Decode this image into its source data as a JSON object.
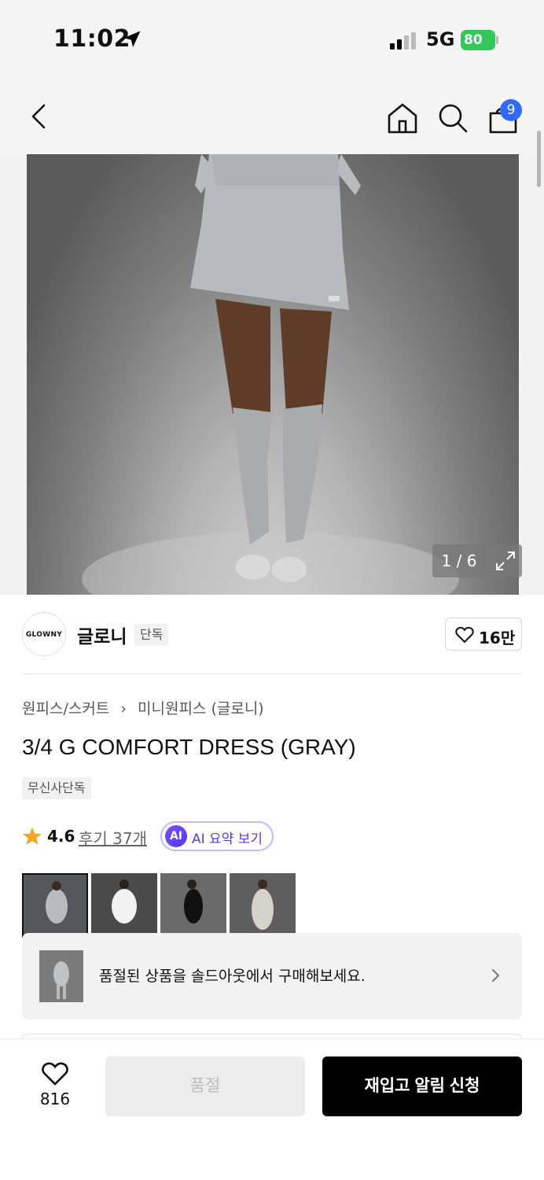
{
  "status_bar": {
    "time": "11:02",
    "network": "5G",
    "battery": "80"
  },
  "nav": {
    "cart_count": "9"
  },
  "gallery": {
    "counter": "1 / 6"
  },
  "brand": {
    "logo_text": "GLOWNY",
    "name": "글로니",
    "tag": "단독",
    "likes": "16만"
  },
  "product": {
    "breadcrumb": [
      "원피스/스커트",
      "미니원피스 (글로니)"
    ],
    "title": "3/4 G COMFORT DRESS (GRAY)",
    "exclusive_tag": "무신사단독",
    "rating": "4.6",
    "review_link": "후기 37개",
    "ai_badge": "AI",
    "ai_summary": "AI 요약 보기"
  },
  "soldout_banner": {
    "text": "품절된 상품을 솔드아웃에서 구매해보세요."
  },
  "bottom": {
    "wish_count": "816",
    "soldout_label": "품절",
    "restock_label": "재입고 알림 신청"
  },
  "colors": {
    "accent_blue": "#2f6bff",
    "star": "#f5a623",
    "ai_purple": "#5a3de0"
  }
}
